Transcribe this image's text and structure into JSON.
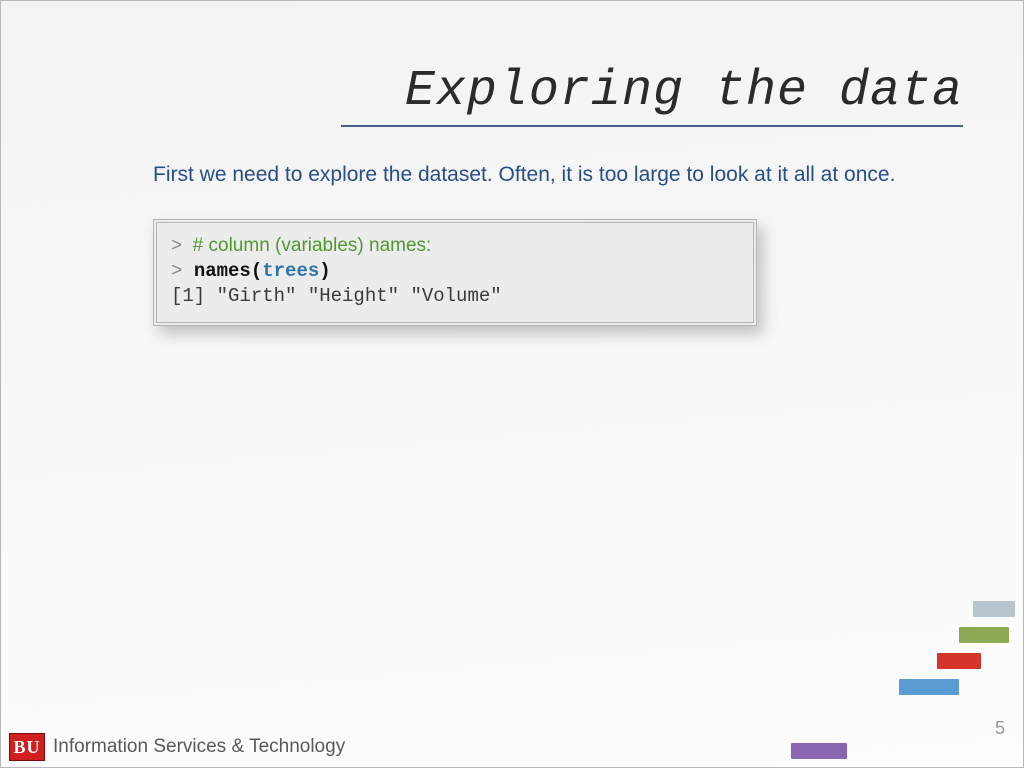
{
  "title": "Exploring the data",
  "subtitle": "First we need to explore the dataset. Often, it is too large to look at it all at once.",
  "code": {
    "prompt": ">",
    "comment": "# column (variables) names:",
    "command_prefix": "names(",
    "command_arg": "trees",
    "command_suffix": ")",
    "output": "[1] \"Girth\"  \"Height\" \"Volume\""
  },
  "footer": {
    "logo": "BU",
    "org": "Information Services & Technology"
  },
  "page_number": "5",
  "colors": {
    "gray": "#b8c5cf",
    "green": "#8ea954",
    "red": "#d5342b",
    "blue": "#5a9bd4",
    "purple": "#8a66b0"
  }
}
